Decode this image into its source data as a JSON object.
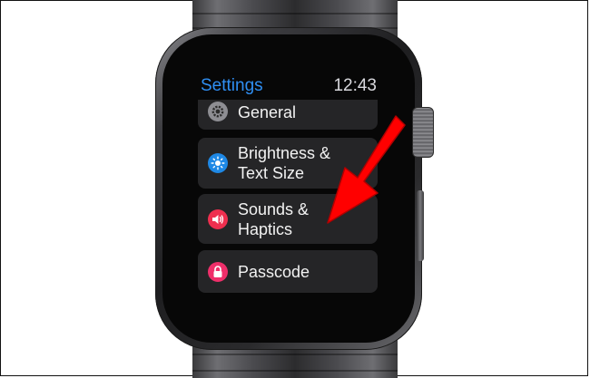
{
  "screen": {
    "title": "Settings",
    "time": "12:43"
  },
  "menu": {
    "items": [
      {
        "label": "General",
        "icon": "gear-icon",
        "icon_color": "#8e8e93"
      },
      {
        "label": "Brightness &\nText Size",
        "icon": "sun-icon",
        "icon_color": "#1e88e5"
      },
      {
        "label": "Sounds &\nHaptics",
        "icon": "speaker-icon",
        "icon_color": "#ef2f4f"
      },
      {
        "label": "Passcode",
        "icon": "lock-icon",
        "icon_color": "#ef2f6a"
      }
    ]
  },
  "colors": {
    "title": "#2f8ff3",
    "annotation_arrow": "#ff0000",
    "row_background": "#252527"
  }
}
